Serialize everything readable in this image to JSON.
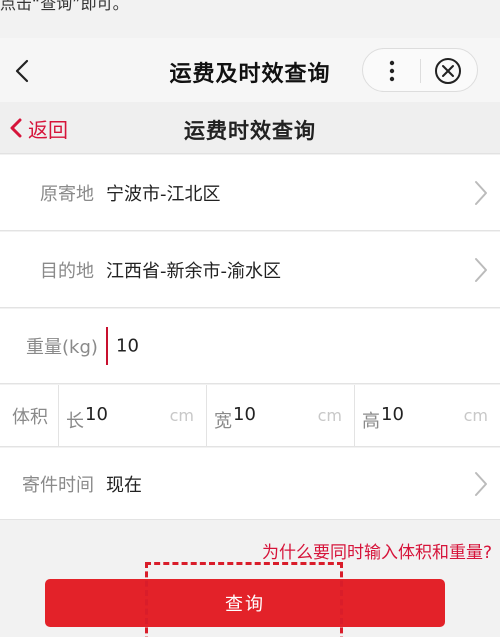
{
  "caption": "点击“查询”即可。",
  "header": {
    "title": "运费及时效查询"
  },
  "sub_header": {
    "back_label": "返回",
    "title": "运费时效查询"
  },
  "form": {
    "origin": {
      "label": "原寄地",
      "value": "宁波市-江北区"
    },
    "destination": {
      "label": "目的地",
      "value": "江西省-新余市-渝水区"
    },
    "weight": {
      "label": "重量(kg)",
      "value": "10"
    },
    "volume": {
      "label": "体积",
      "length": {
        "prefix": "长",
        "value": "10",
        "unit": "cm"
      },
      "width": {
        "prefix": "宽",
        "value": "10",
        "unit": "cm"
      },
      "height": {
        "prefix": "高",
        "value": "10",
        "unit": "cm"
      }
    },
    "send_time": {
      "label": "寄件时间",
      "value": "现在"
    }
  },
  "help_link": "为什么要同时输入体积和重量?",
  "query_button": "查询",
  "colors": {
    "accent": "#e32229",
    "link": "#d6143a"
  }
}
